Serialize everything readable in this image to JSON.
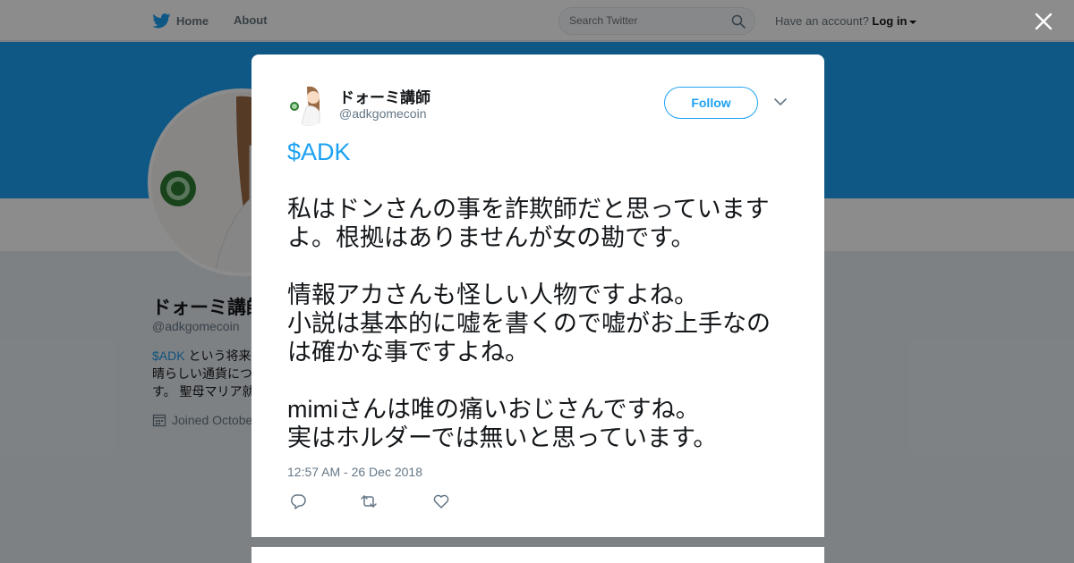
{
  "topbar": {
    "home_label": "Home",
    "about_label": "About",
    "search_placeholder": "Search Twitter",
    "account_prompt": "Have an account?",
    "login_label": "Log in"
  },
  "profile": {
    "name": "ドォーミ講師",
    "handle": "@adkgomecoin",
    "bio_cashtag": "$ADK",
    "bio_line1": " という将来",
    "bio_line2": "晴らしい通貨につ",
    "bio_line3": "す。 聖母マリア就",
    "joined": "Joined Octobe"
  },
  "tweet": {
    "name": "ドォーミ講師",
    "handle": "@adkgomecoin",
    "follow_label": "Follow",
    "cashtag": "$ADK",
    "body": "\n\n私はドンさんの事を詐欺師だと思っていますよ。根拠はありませんが女の勘です。\n\n情報アカさんも怪しい人物ですよね。\n小説は基本的に嘘を書くので嘘がお上手なのは確かな事ですよね。\n\nmimiさんは唯の痛いおじさんですね。\n実はホルダーでは無いと思っています。",
    "timestamp": "12:57 AM - 26 Dec 2018"
  },
  "colors": {
    "brand_blue": "#1da1f2",
    "link_blue": "#1b95e0",
    "text": "#14171a",
    "muted": "#657786"
  },
  "icons": {
    "logo": "twitter-bird-icon",
    "search": "search-icon",
    "close": "close-icon",
    "caret": "chevron-down-icon",
    "reply": "reply-icon",
    "retweet": "retweet-icon",
    "like": "heart-icon",
    "calendar": "calendar-icon"
  }
}
